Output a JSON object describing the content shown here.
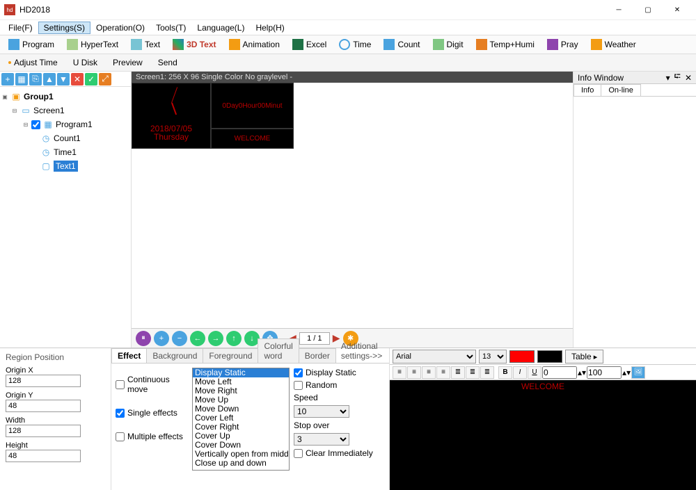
{
  "title": "HD2018",
  "menu": {
    "file": "File(F)",
    "settings": "Settings(S)",
    "operation": "Operation(O)",
    "tools": "Tools(T)",
    "language": "Language(L)",
    "help": "Help(H)"
  },
  "ribbon": {
    "program": "Program",
    "hypertext": "HyperText",
    "text": "Text",
    "text3d": "3D Text",
    "animation": "Animation",
    "excel": "Excel",
    "time": "Time",
    "count": "Count",
    "digit": "Digit",
    "temphumi": "Temp+Humi",
    "pray": "Pray",
    "weather": "Weather"
  },
  "ribbon2": {
    "adjust": "Adjust Time",
    "udisk": "U Disk",
    "preview": "Preview",
    "send": "Send"
  },
  "tree": {
    "group": "Group1",
    "screen": "Screen1",
    "program": "Program1",
    "count": "Count1",
    "time": "Time1",
    "text": "Text1"
  },
  "screen_header": "Screen1: 256 X 96  Single Color No graylevel -",
  "led": {
    "date": "2018/07/05",
    "day": "Thursday",
    "counter": "0Day0Hour00Minut",
    "welcome": "WELCOME"
  },
  "pager": {
    "page": "1 / 1"
  },
  "info": {
    "title": "Info Window",
    "tab_info": "Info",
    "tab_online": "On-line"
  },
  "region": {
    "title": "Region Position",
    "ox_lbl": "Origin X",
    "ox": "128",
    "oy_lbl": "Origin Y",
    "oy": "48",
    "w_lbl": "Width",
    "w": "128",
    "h_lbl": "Height",
    "h": "48"
  },
  "fx": {
    "tabs": {
      "effect": "Effect",
      "background": "Background",
      "foreground": "Foreground",
      "colorful": "Colorful word",
      "border": "Border",
      "more": "Additional settings->>"
    },
    "continuous": "Continuous move",
    "single": "Single effects",
    "multiple": "Multiple effects",
    "list": [
      "Display Static",
      "Move Left",
      "Move Right",
      "Move Up",
      "Move Down",
      "Cover Left",
      "Cover Right",
      "Cover Up",
      "Cover Down",
      "Vertically open from middle",
      "Close up and down"
    ],
    "display_static": "Display Static",
    "random": "Random",
    "speed_lbl": "Speed",
    "speed": "10",
    "stop_lbl": "Stop over",
    "stop": "3",
    "clear": "Clear Immediately"
  },
  "editor": {
    "font": "Arial",
    "size": "13",
    "table": "Table",
    "num1": "0",
    "num2": "100",
    "preview": "WELCOME"
  }
}
